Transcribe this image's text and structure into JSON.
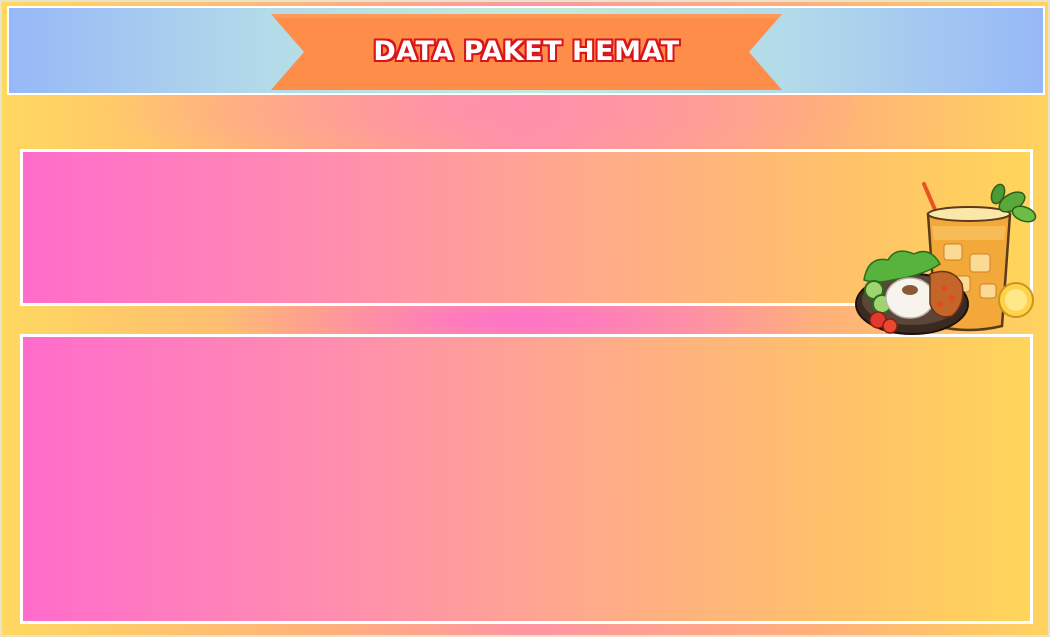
{
  "header": {
    "title": "DATA PAKET HEMAT"
  },
  "illustration": {
    "icon": "food-drink-illustration-icon"
  },
  "colors": {
    "ribbon": "#ff8d4a",
    "title_outline": "#d9141b",
    "panel_left": "#ff6ccb",
    "panel_right": "#ffd55a",
    "header_edge": "#97b8f8",
    "header_center": "#c6ead9"
  }
}
